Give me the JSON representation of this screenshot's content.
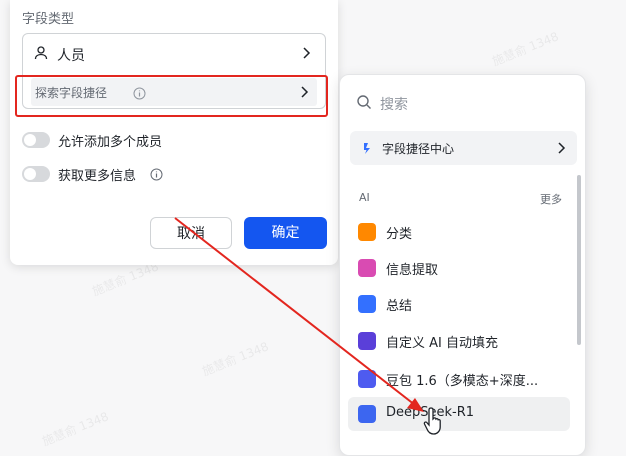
{
  "panel": {
    "section_label": "字段类型",
    "field_type": "人员",
    "shortcut_label": "探索字段捷径",
    "toggles": [
      {
        "label": "允许添加多个成员",
        "on": false
      },
      {
        "label": "获取更多信息",
        "on": false
      }
    ],
    "cancel": "取消",
    "confirm": "确定"
  },
  "dropdown": {
    "search_placeholder": "搜索",
    "center_label": "字段捷径中心",
    "group_label": "AI",
    "more_label": "更多",
    "items": [
      {
        "label": "分类",
        "color": "#ff8800"
      },
      {
        "label": "信息提取",
        "color": "#d94bb2"
      },
      {
        "label": "总结",
        "color": "#3370ff"
      },
      {
        "label": "自定义 AI 自动填充",
        "color": "#5a3fd9"
      },
      {
        "label": "豆包 1.6（多模态+深度...",
        "color": "#4e5bf0"
      },
      {
        "label": "DeepSeek-R1",
        "color": "#3c66f0"
      }
    ]
  },
  "watermark": "施慧俞 1348",
  "colors": {
    "primary": "#1456f0",
    "highlight": "#e3261f"
  }
}
